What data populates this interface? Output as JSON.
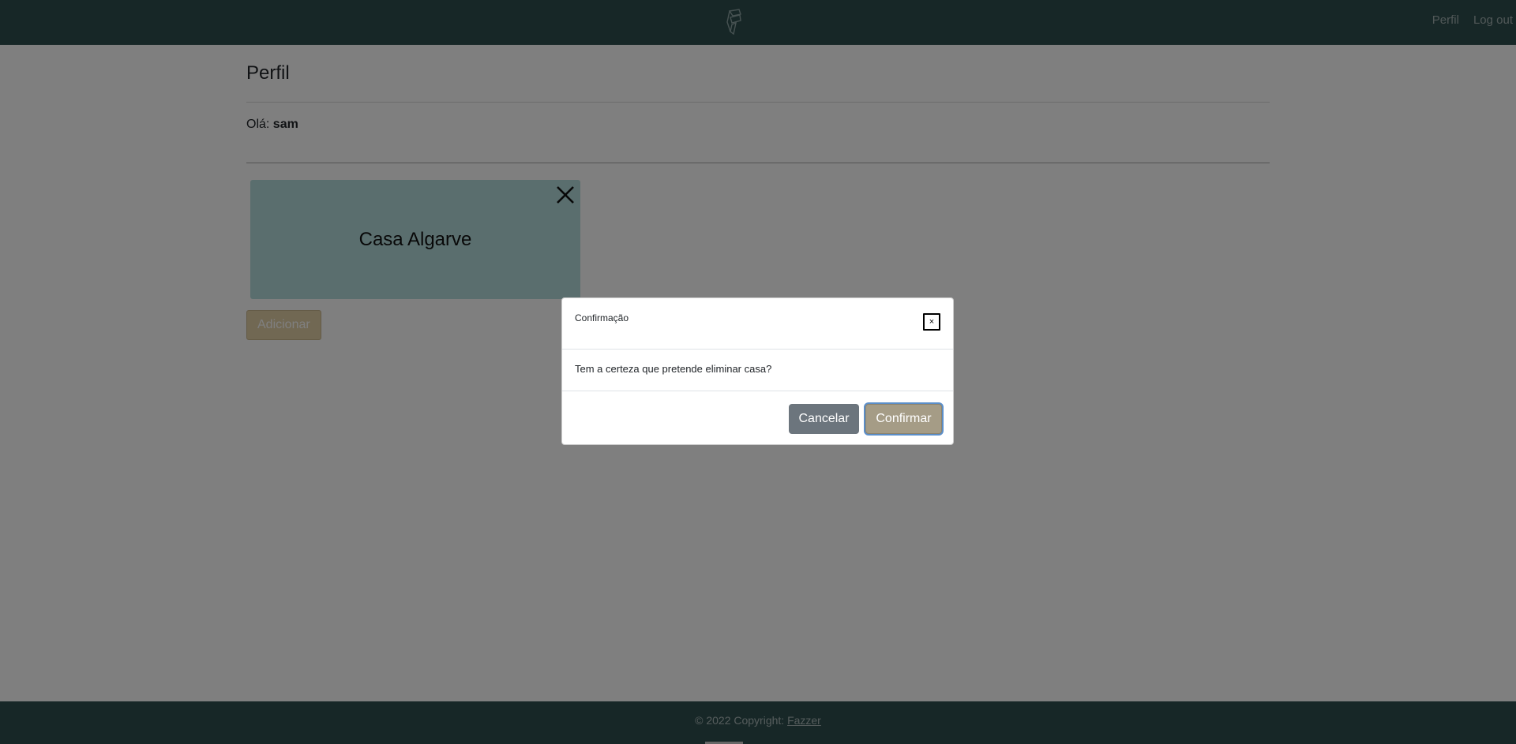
{
  "navbar": {
    "logo_icon": "fazzer-logo-icon",
    "links": [
      {
        "label": "Perfil"
      },
      {
        "label": "Log out"
      }
    ]
  },
  "page": {
    "title": "Perfil",
    "greeting_prefix": "Olá: ",
    "username": "sam"
  },
  "houses": [
    {
      "name": "Casa Algarve",
      "delete_icon": "close-icon"
    }
  ],
  "add_button_label": "Adicionar",
  "modal": {
    "title": "Confirmação",
    "close_label": "×",
    "message": "Tem a certeza que pretende eliminar casa?",
    "cancel_label": "Cancelar",
    "confirm_label": "Confirmar"
  },
  "footer": {
    "text": "© 2022 Copyright: ",
    "link_label": "Fazzer"
  },
  "colors": {
    "navbar_bg": "#2f4f4f",
    "card_bg": "#b5dcdc",
    "add_button_bg": "#e2d0a6",
    "cancel_bg": "#6c757d",
    "confirm_bg": "#a59c86"
  }
}
